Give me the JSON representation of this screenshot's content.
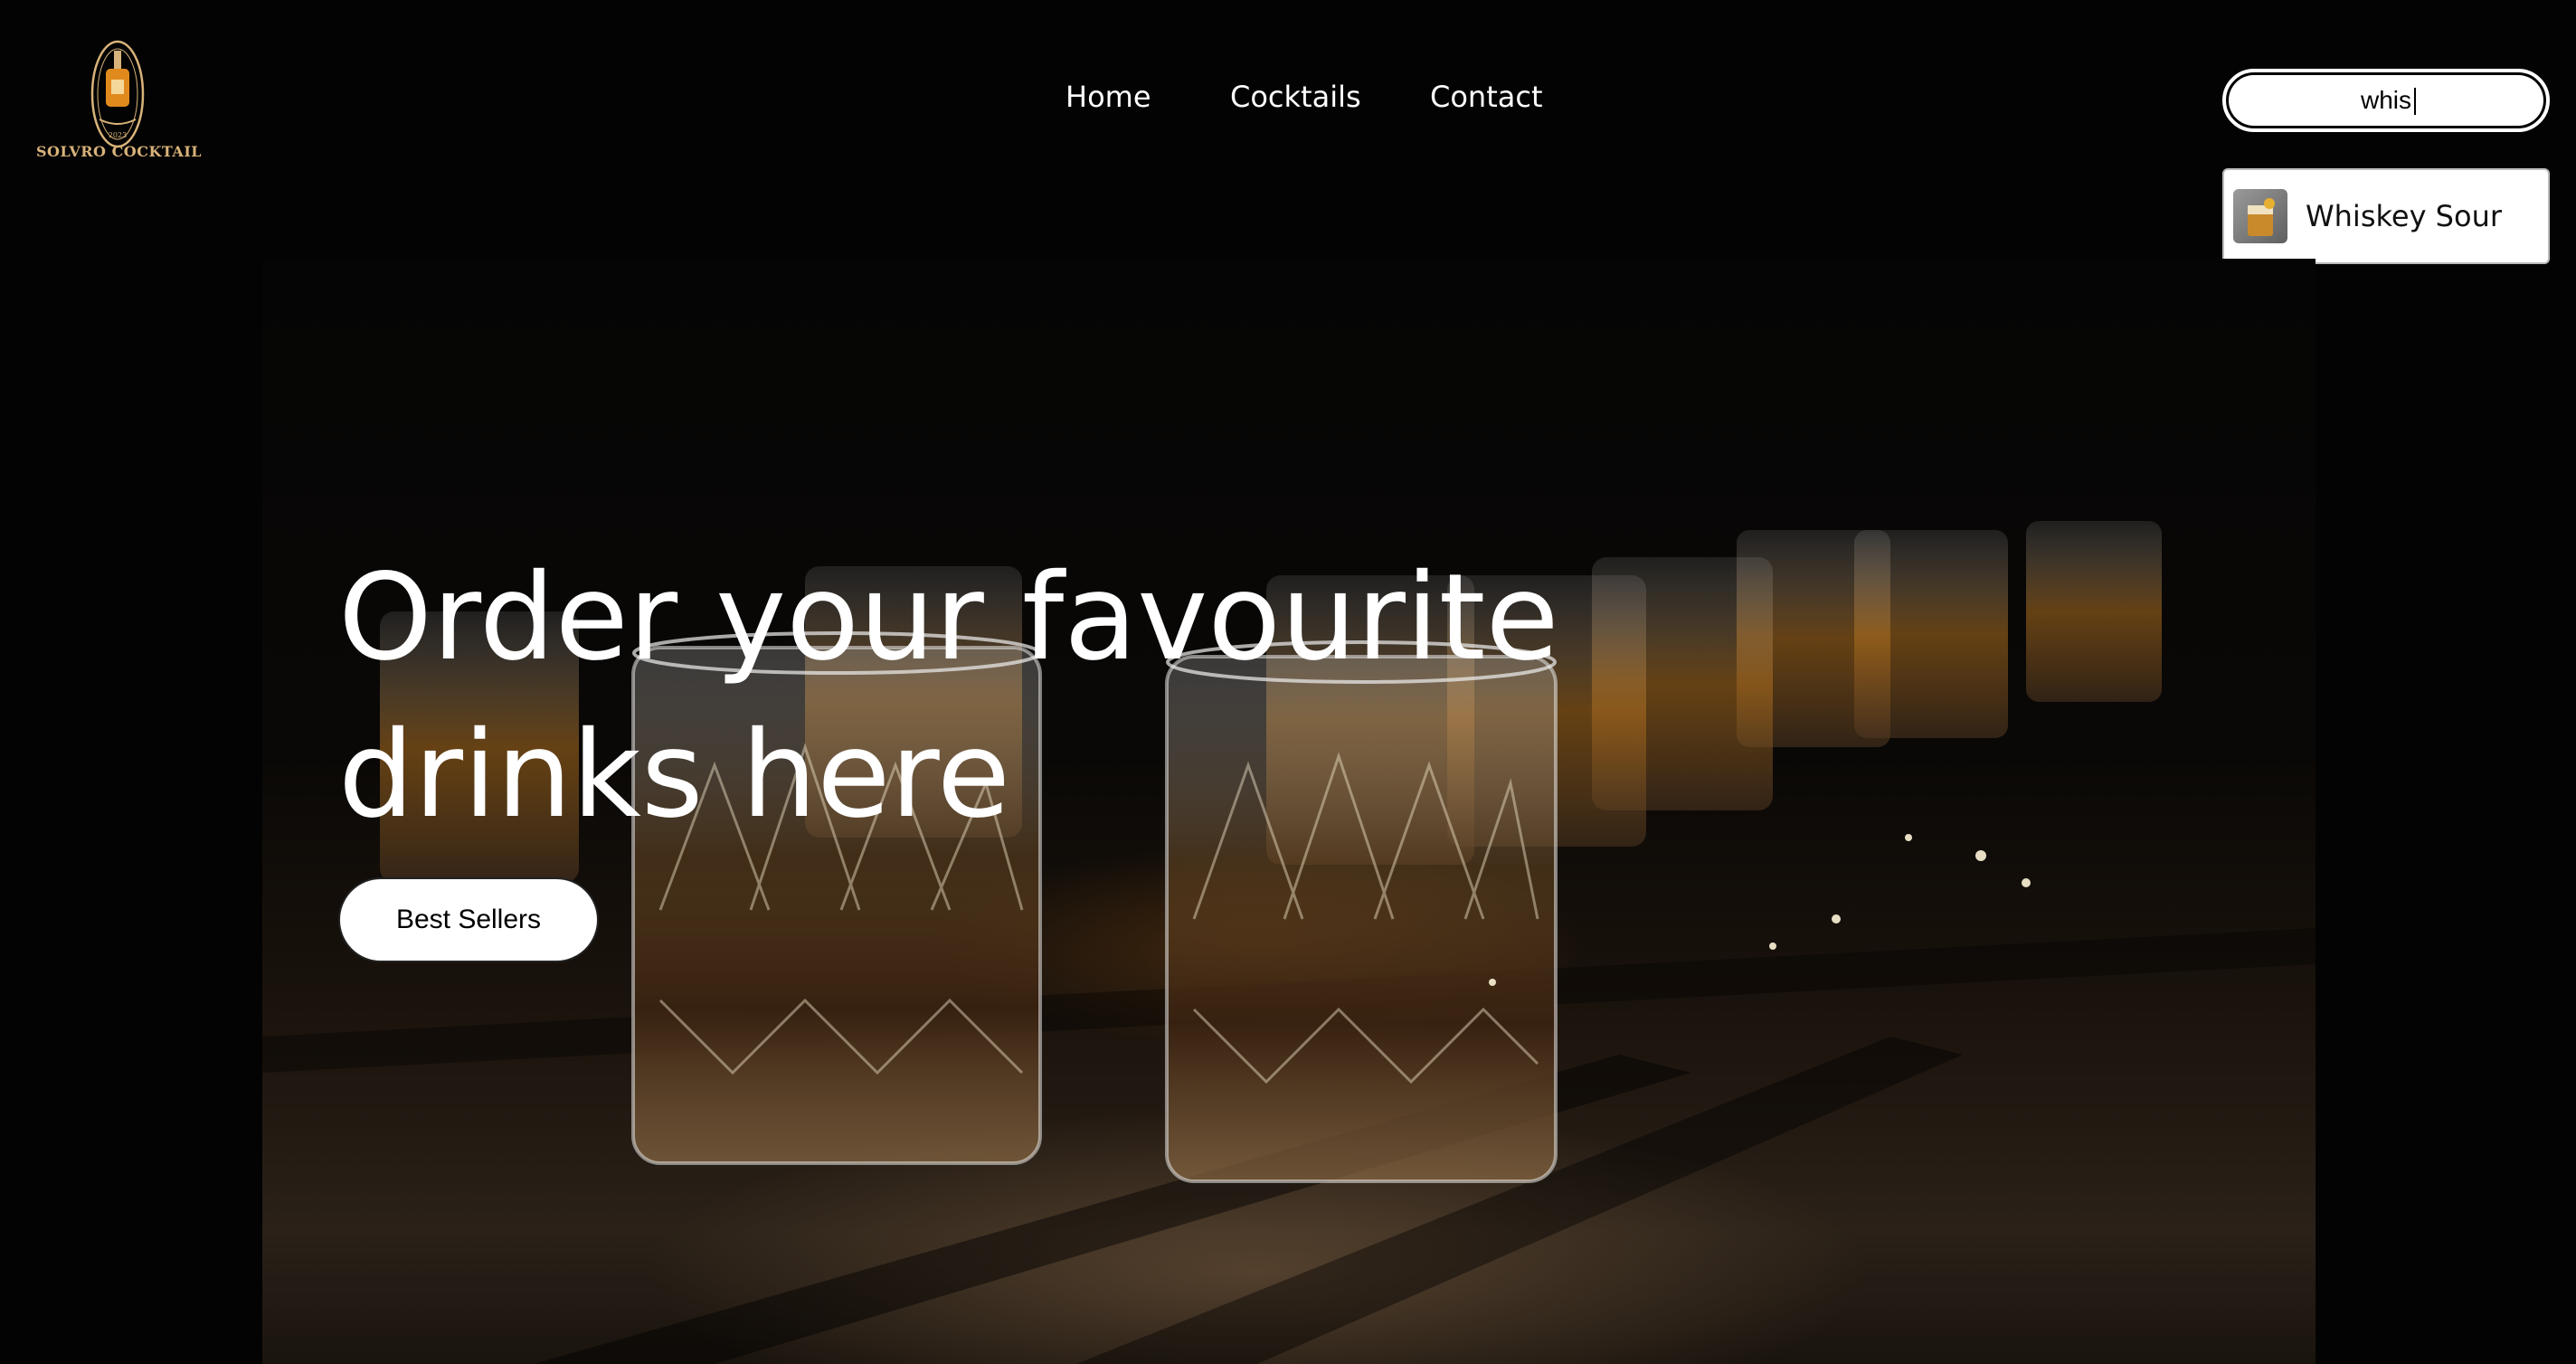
{
  "brand": {
    "logo_text": "SOLVRO COCKTAIL",
    "icon": "whiskey-bottle-icon",
    "accent_color": "#d9b37a"
  },
  "nav": {
    "items": [
      {
        "label": "Home"
      },
      {
        "label": "Cocktails"
      },
      {
        "label": "Contact"
      }
    ]
  },
  "search": {
    "value": "whis",
    "placeholder": "",
    "suggestions": [
      {
        "label": "Whiskey Sour",
        "icon": "cocktail-thumbnail"
      }
    ]
  },
  "hero": {
    "headline_line1": "Order your favourite",
    "headline_line2": "drinks here",
    "cta_label": "Best Sellers",
    "image": "whiskey-glasses-photo"
  }
}
